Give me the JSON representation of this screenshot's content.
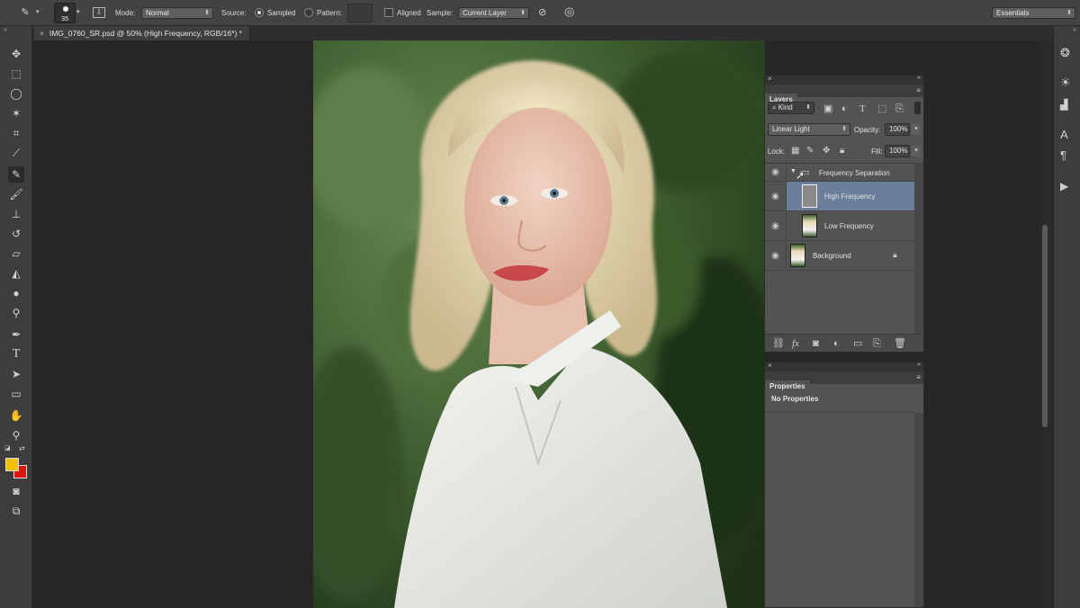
{
  "options_bar": {
    "brush_size": "35",
    "mode_label": "Mode:",
    "mode_value": "Normal",
    "source_label": "Source:",
    "sampled_label": "Sampled",
    "pattern_label": "Pattern:",
    "aligned_label": "Aligned",
    "sample_label": "Sample:",
    "sample_value": "Current Layer",
    "workspace": "Essentials"
  },
  "document": {
    "tab_title": "IMG_0760_SR.psd @ 50% (High Frequency, RGB/16*) *"
  },
  "layers_panel": {
    "title": "Layers",
    "filter_label": "Kind",
    "blend_mode": "Linear Light",
    "opacity_label": "Opacity:",
    "opacity_value": "100%",
    "lock_label": "Lock:",
    "fill_label": "Fill:",
    "fill_value": "100%",
    "layers": [
      {
        "name": "Frequency Separation",
        "type": "group"
      },
      {
        "name": "High Frequency",
        "type": "layer",
        "selected": true
      },
      {
        "name": "Low Frequency",
        "type": "layer"
      },
      {
        "name": "Background",
        "type": "background",
        "locked": true
      }
    ]
  },
  "properties_panel": {
    "title": "Properties",
    "content": "No Properties"
  },
  "colors": {
    "foreground": "#f2c200",
    "background": "#e01010",
    "selected_layer": "#6b7f9a"
  }
}
